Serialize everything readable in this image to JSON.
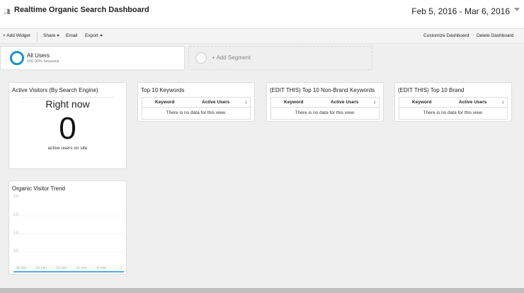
{
  "header": {
    "title": "Realtime Organic Search Dashboard",
    "date_range": "Feb 5, 2016 - Mar 6, 2016"
  },
  "toolbar": {
    "add_widget": "+ Add Widget",
    "share": "Share",
    "email": "Email",
    "export": "Export",
    "customize": "Customize Dashboard",
    "delete": "Delete Dashboard"
  },
  "segments": {
    "all_users": "All Users",
    "all_users_sub": "100.00% Sessions",
    "add_segment": "+ Add Segment"
  },
  "widgets": {
    "active_visitors": {
      "title": "Active Visitors (By Search Engine)",
      "right_now": "Right now",
      "count": "0",
      "caption": "active users on site"
    },
    "top_keywords": {
      "title": "Top 10 Keywords",
      "col_keyword": "Keyword",
      "col_active": "Active Users",
      "empty": "There is no data for this view."
    },
    "nonbrand_keywords": {
      "title": "(EDIT THIS) Top 10 Non-Brand Keywords",
      "col_keyword": "Keyword",
      "col_active": "Active Users",
      "empty": "There is no data for this view."
    },
    "brand": {
      "title": "(EDIT THIS) Top 10 Brand",
      "col_keyword": "Keyword",
      "col_active": "Active Users",
      "empty": "There is no data for this view."
    },
    "trend": {
      "title": "Organic Visitor Trend"
    }
  },
  "chart_data": {
    "type": "line",
    "title": "Organic Visitor Trend",
    "x": [
      "-26 min",
      "-21 min",
      "-16 min",
      "-11 min",
      "-6 min",
      "-1"
    ],
    "y_ticks": [
      "2.0",
      "1.5",
      "1.0",
      "0.5"
    ],
    "ylim": [
      0,
      2
    ],
    "series": [
      {
        "values": [
          0,
          0,
          0,
          0,
          0,
          0
        ]
      }
    ],
    "grid": true,
    "line_color": "#1a91d1"
  },
  "colors": {
    "accent": "#1a91d1",
    "background": "#efefef"
  }
}
